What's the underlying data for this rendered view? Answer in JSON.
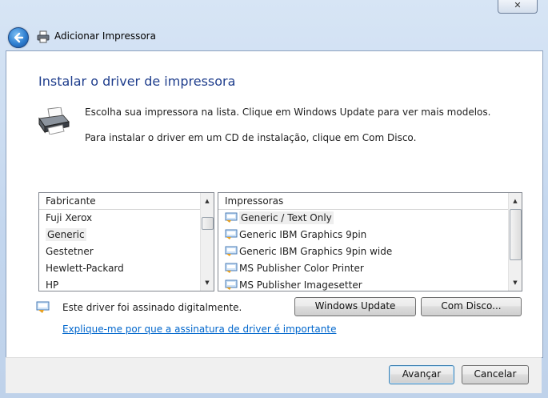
{
  "window": {
    "title": "Adicionar Impressora",
    "close_label": "✕"
  },
  "page": {
    "heading": "Instalar o driver de impressora",
    "instruction_1": "Escolha sua impressora na lista. Clique em Windows Update para ver mais modelos.",
    "instruction_2": "Para instalar o driver em um CD de instalação, clique em Com Disco."
  },
  "manufacturers": {
    "header": "Fabricante",
    "items": [
      "Fuji Xerox",
      "Generic",
      "Gestetner",
      "Hewlett-Packard",
      "HP"
    ],
    "selected": "Generic"
  },
  "printers": {
    "header": "Impressoras",
    "items": [
      "Generic / Text Only",
      "Generic IBM Graphics 9pin",
      "Generic IBM Graphics 9pin wide",
      "MS Publisher Color Printer",
      "MS Publisher Imagesetter"
    ],
    "selected": "Generic / Text Only"
  },
  "signature": {
    "note": "Este driver foi assinado digitalmente.",
    "link": "Explique-me por que a assinatura de driver é importante"
  },
  "buttons": {
    "windows_update": "Windows Update",
    "have_disk": "Com Disco...",
    "next": "Avançar",
    "cancel": "Cancelar"
  }
}
